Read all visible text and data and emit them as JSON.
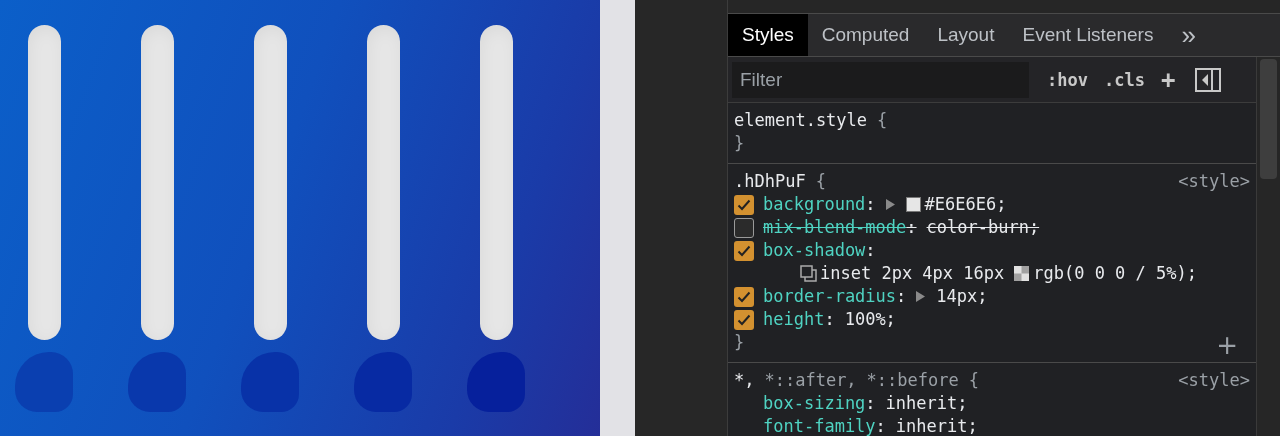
{
  "preview": {
    "bars": [
      {
        "kind": "track"
      },
      {
        "kind": "track"
      },
      {
        "kind": "track"
      },
      {
        "kind": "track"
      },
      {
        "kind": "track"
      }
    ]
  },
  "devtools": {
    "tabs": [
      {
        "label": "Styles",
        "selected": true
      },
      {
        "label": "Computed",
        "selected": false
      },
      {
        "label": "Layout",
        "selected": false
      },
      {
        "label": "Event Listeners",
        "selected": false
      }
    ],
    "more": "»",
    "filter": {
      "placeholder": "Filter"
    },
    "toolbar": [
      ":hov",
      ".cls",
      "+"
    ],
    "rules": [
      {
        "selector": [
          {
            "text": "element.style",
            "matched": true
          }
        ],
        "open": "{",
        "close": "}"
      },
      {
        "selector": [
          {
            "text": ".hDhPuF",
            "matched": true
          }
        ],
        "open": "{",
        "close": "}",
        "source": "<style>",
        "add": "+",
        "declarations": [
          {
            "kind": "toggle",
            "checked": true,
            "overridden": false,
            "property": "background",
            "colon": ":",
            "expandable": true,
            "swatch": true,
            "color": "#e6e6e6",
            "value": "#E6E6E6;"
          },
          {
            "kind": "toggle",
            "checked": false,
            "overridden": true,
            "property": "mix-blend-mode",
            "colon": ":",
            "value": "color-burn;"
          },
          {
            "kind": "toggle",
            "checked": true,
            "overridden": false,
            "property": "box-shadow",
            "colon": ":",
            "wrapped": true,
            "swatch": true,
            "value": "inset 2px 4px 16px",
            "value_after": "rgb(0 0 0 / 5%);"
          },
          {
            "kind": "toggle",
            "checked": true,
            "overridden": false,
            "property": "border-radius",
            "colon": ":",
            "expandable": true,
            "value": "14px;"
          },
          {
            "kind": "toggle",
            "checked": true,
            "overridden": false,
            "property": "height",
            "colon": ":",
            "value": "100%;"
          }
        ]
      },
      {
        "selector": [
          {
            "text": "*,",
            "matched": true
          },
          {
            "text": "*::after,",
            "matched": false
          },
          {
            "text": "*::before",
            "matched": false
          }
        ],
        "open": "{",
        "source": "<style>",
        "declarations": [
          {
            "kind": "plain",
            "overridden": false,
            "property": "box-sizing",
            "colon": ":",
            "value": "inherit;"
          },
          {
            "kind": "plain",
            "overridden": false,
            "property": "font-family",
            "colon": ":",
            "value": "inherit;"
          }
        ]
      }
    ]
  }
}
